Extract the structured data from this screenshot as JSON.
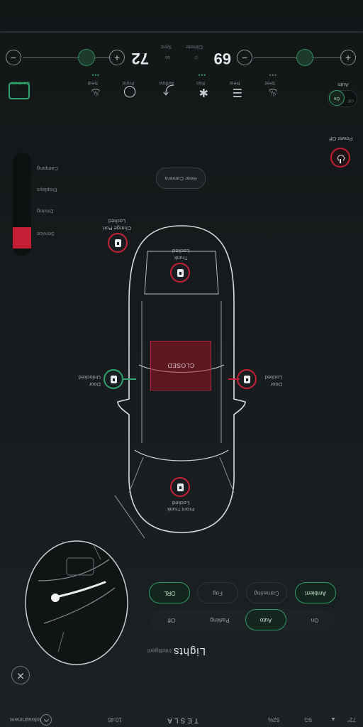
{
  "status": {
    "brand": "TESLA",
    "time": "10:45",
    "temp_out": "72°",
    "signal": "5G",
    "battery": "52%",
    "left_label": "Infotainment"
  },
  "lights": {
    "title": "Lights",
    "subtitle": "Intelligent",
    "modes": [
      "Off",
      "Parking",
      "Auto",
      "On"
    ],
    "active_mode": "Auto",
    "buttons": [
      "DRL",
      "Fog",
      "Cornering",
      "Ambient"
    ],
    "active_buttons": [
      "DRL",
      "Ambient"
    ]
  },
  "car": {
    "front_trunk": {
      "title": "Front Trunk",
      "state": "Locked"
    },
    "rear_trunk": {
      "title": "Trunk",
      "state": "Locked"
    },
    "charge_port": {
      "title": "Charge Port",
      "state": "Locked"
    },
    "door_left": {
      "title": "Door",
      "state": "Unlocked"
    },
    "door_right": {
      "title": "Door",
      "state": "Locked"
    },
    "roof_state": "CLOSED",
    "camera_button": "Rear Camera"
  },
  "side_menu": {
    "items": [
      "Camping",
      "Displays",
      "Driving",
      "Service"
    ],
    "active": "Service"
  },
  "power_label": "Power Off",
  "controls": {
    "items": [
      "Controls",
      "Seat",
      "Front",
      "Airflow",
      "Fan",
      "Rear",
      "Seat"
    ],
    "auto_label": "Auto",
    "toggle_on": "On",
    "toggle_off": "Off"
  },
  "climate": {
    "left_temp": "72",
    "right_temp": "69",
    "mid_labels": [
      "Sync",
      "Climate"
    ]
  },
  "colors": {
    "accent_green": "#2fa36b",
    "accent_red": "#c41e34",
    "background": "#131617"
  }
}
